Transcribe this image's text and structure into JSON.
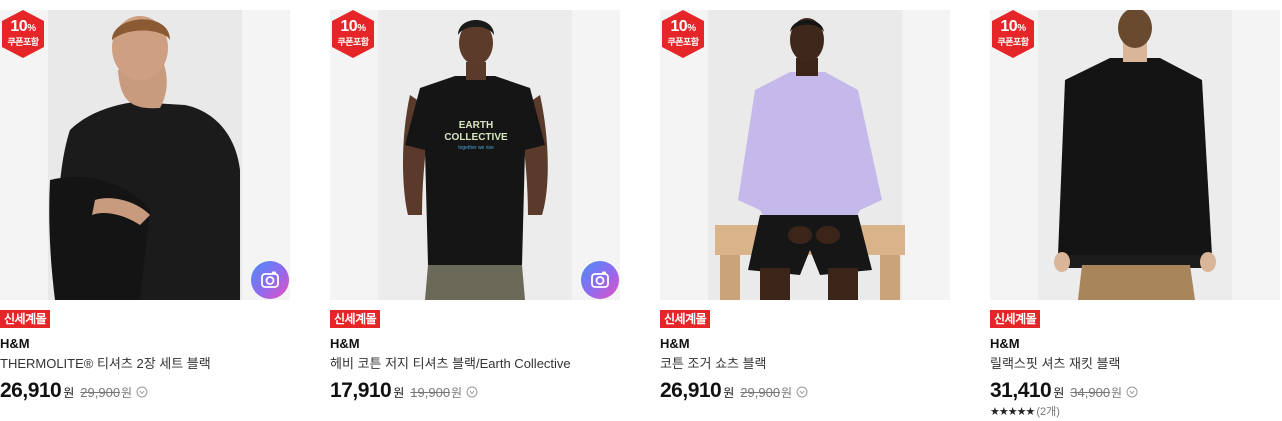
{
  "coupon_badge": {
    "percent": "10",
    "unit": "%",
    "label": "쿠폰포함",
    "color": "#e52528"
  },
  "currency_unit": "원",
  "products": [
    {
      "badge": "신세계몰",
      "brand": "H&M",
      "name": "THERMOLITE® 티셔츠 2장 세트 블랙",
      "price": "26,910",
      "original_price": "29,900",
      "has_review_photo": true,
      "image": "model-black-tshirt-seated"
    },
    {
      "badge": "신세계몰",
      "brand": "H&M",
      "name": "헤비 코튼 저지 티셔츠 블랙/Earth Collective",
      "price": "17,910",
      "original_price": "19,900",
      "has_review_photo": true,
      "image": "model-black-graphic-tshirt",
      "shirt_print": [
        "EARTH",
        "COLLECTIVE",
        "together we rise"
      ]
    },
    {
      "badge": "신세계몰",
      "brand": "H&M",
      "name": "코튼 조거 쇼츠 블랙",
      "price": "26,910",
      "original_price": "29,900",
      "has_review_photo": false,
      "image": "model-lavender-sweatshirt-black-shorts"
    },
    {
      "badge": "신세계몰",
      "brand": "H&M",
      "name": "릴랙스핏 셔츠 재킷 블랙",
      "price": "31,410",
      "original_price": "34,900",
      "has_review_photo": false,
      "image": "model-black-shirt-jacket-back",
      "rating_stars": "★★★★★",
      "rating_count": "(2개)"
    }
  ]
}
